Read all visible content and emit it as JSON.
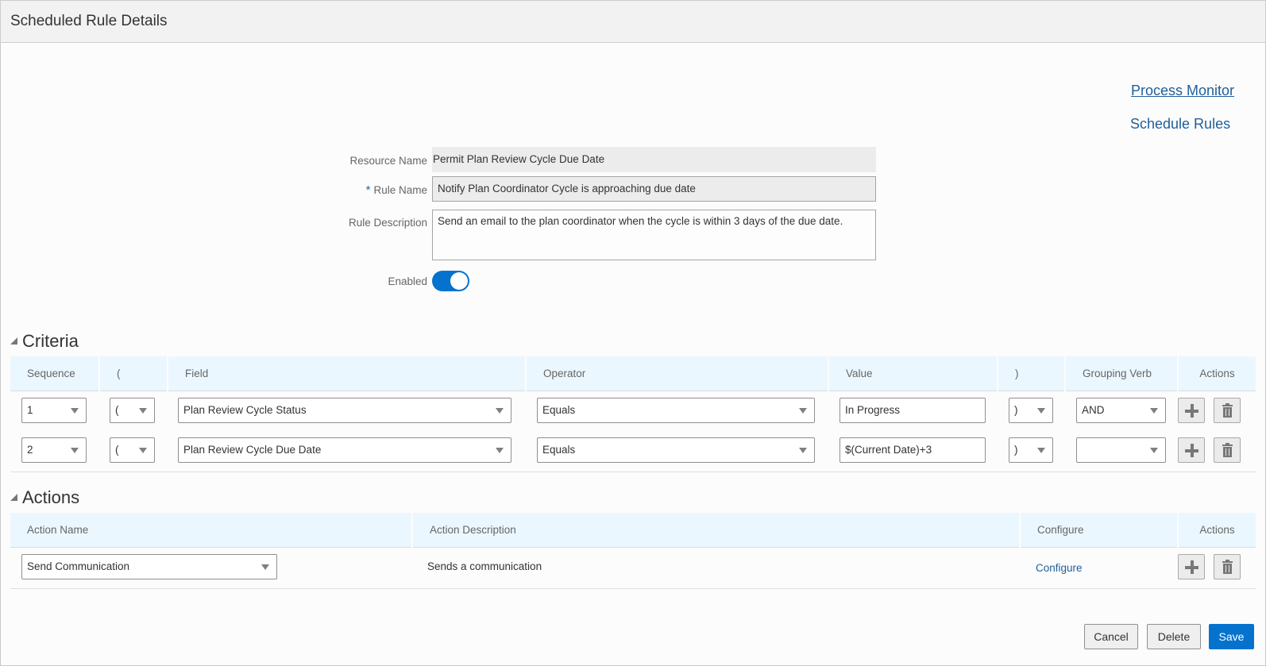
{
  "header": {
    "title": "Scheduled Rule Details"
  },
  "links": {
    "process_monitor": "Process Monitor",
    "schedule_rules": "Schedule Rules"
  },
  "form": {
    "resource_name_label": "Resource Name",
    "resource_name_value": "Permit Plan Review Cycle Due Date",
    "required_marker": "*",
    "rule_name_label": "Rule Name",
    "rule_name_value": "Notify Plan Coordinator Cycle is approaching due date",
    "rule_description_label": "Rule Description",
    "rule_description_value": "Send an email to the plan coordinator when the cycle is within 3 days of the due date.",
    "enabled_label": "Enabled",
    "enabled": true
  },
  "criteria": {
    "title": "Criteria",
    "columns": [
      "Sequence",
      "(",
      "Field",
      "Operator",
      "Value",
      ")",
      "Grouping Verb",
      "Actions"
    ],
    "rows": [
      {
        "sequence": "1",
        "open_paren": "(",
        "field": "Plan Review Cycle Status",
        "operator": "Equals",
        "value": "In Progress",
        "close_paren": ")",
        "grouping_verb": "AND"
      },
      {
        "sequence": "2",
        "open_paren": "(",
        "field": "Plan Review Cycle Due Date",
        "operator": "Equals",
        "value": "$(Current Date)+3",
        "close_paren": ")",
        "grouping_verb": ""
      }
    ]
  },
  "actions": {
    "title": "Actions",
    "columns": [
      "Action Name",
      "Action Description",
      "Configure",
      "Actions"
    ],
    "rows": [
      {
        "action_name": "Send Communication",
        "action_description": "Sends a communication",
        "configure_link": "Configure"
      }
    ]
  },
  "footer": {
    "cancel": "Cancel",
    "delete": "Delete",
    "save": "Save"
  },
  "colors": {
    "accent": "#0572ce",
    "link": "#1e5f99",
    "table_header_bg": "#ebf7fe"
  }
}
